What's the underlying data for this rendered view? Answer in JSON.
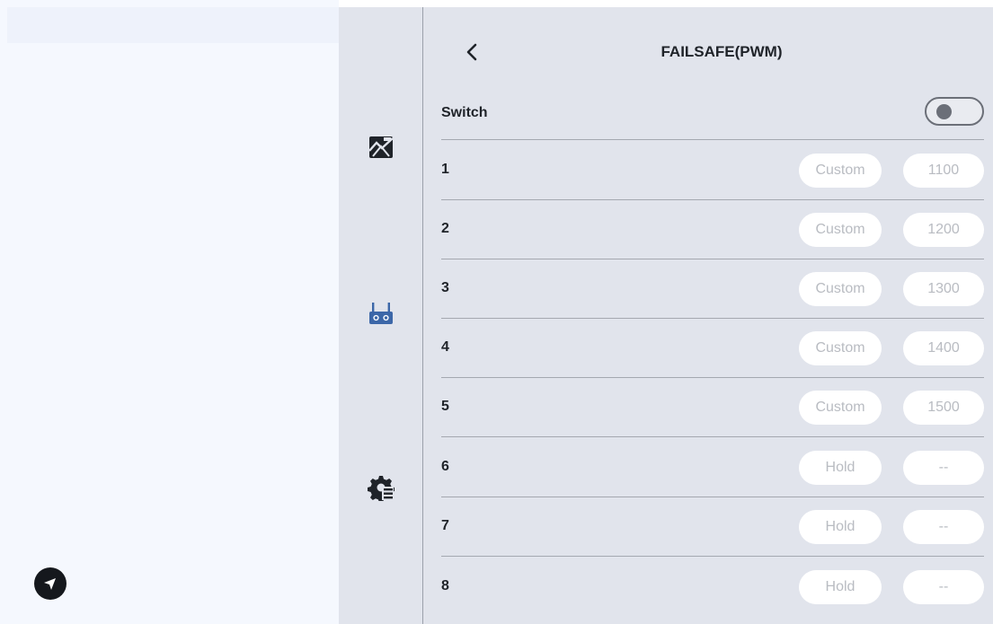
{
  "header": {
    "title": "FAILSAFE(PWM)"
  },
  "switch": {
    "label": "Switch",
    "enabled": false
  },
  "channels": [
    {
      "label": "1",
      "mode": "Custom",
      "value": "1100"
    },
    {
      "label": "2",
      "mode": "Custom",
      "value": "1200"
    },
    {
      "label": "3",
      "mode": "Custom",
      "value": "1300"
    },
    {
      "label": "4",
      "mode": "Custom",
      "value": "1400"
    },
    {
      "label": "5",
      "mode": "Custom",
      "value": "1500"
    },
    {
      "label": "6",
      "mode": "Hold",
      "value": "--"
    },
    {
      "label": "7",
      "mode": "Hold",
      "value": "--"
    },
    {
      "label": "8",
      "mode": "Hold",
      "value": "--"
    }
  ],
  "rail": {
    "icons": [
      "image-settings-icon",
      "remote-controller-icon",
      "gear-list-icon"
    ]
  },
  "sidebar": {
    "nav_icon": "navigation-arrow-icon"
  },
  "colors": {
    "panel_bg": "#e1e4ec",
    "accent": "#3c67a8",
    "pill_text": "#b9bcc2"
  }
}
